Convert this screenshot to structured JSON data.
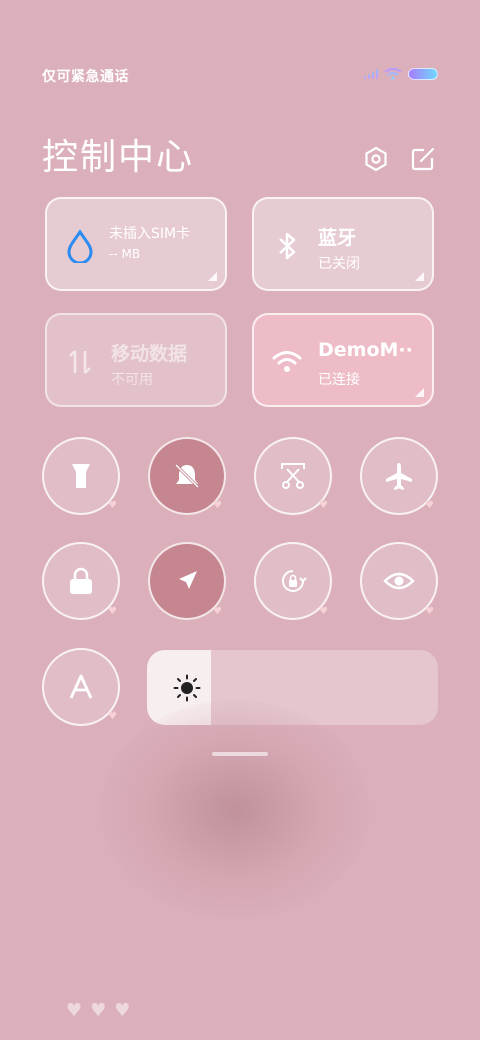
{
  "status_bar": {
    "carrier": "仅可紧急通话",
    "icons": [
      "signal-icon",
      "wifi-icon",
      "battery-icon"
    ]
  },
  "header": {
    "title": "控制中心",
    "settings_icon": "settings-icon",
    "edit_icon": "edit-icon"
  },
  "tiles": [
    {
      "name": "data-usage",
      "line1": "未插入SIM卡",
      "line2": "-- MB",
      "icon": "water-drop-icon",
      "state": "normal"
    },
    {
      "name": "bluetooth",
      "line1": "蓝牙",
      "line2": "已关闭",
      "icon": "bluetooth-icon",
      "state": "normal"
    },
    {
      "name": "mobile-data",
      "line1": "移动数据",
      "line2": "不可用",
      "icon": "data-arrows-icon",
      "state": "disabled"
    },
    {
      "name": "wifi",
      "line1": "DemoM··",
      "line2": "已连接",
      "icon": "wifi-icon",
      "state": "on"
    }
  ],
  "toggles": [
    {
      "name": "flashlight",
      "icon": "flashlight-icon",
      "on": false
    },
    {
      "name": "mute",
      "icon": "bell-off-icon",
      "on": true
    },
    {
      "name": "screenshot",
      "icon": "scissors-icon",
      "on": false
    },
    {
      "name": "airplane",
      "icon": "airplane-icon",
      "on": false
    },
    {
      "name": "lock-screen",
      "icon": "lock-icon",
      "on": false
    },
    {
      "name": "location",
      "icon": "location-arrow-icon",
      "on": true
    },
    {
      "name": "rotation-lock",
      "icon": "rotation-lock-icon",
      "on": false
    },
    {
      "name": "eye-comfort",
      "icon": "eye-icon",
      "on": false
    },
    {
      "name": "auto-text",
      "icon": "letter-a-icon",
      "on": false
    }
  ],
  "brightness": {
    "level": 0.22,
    "icon": "sun-icon"
  },
  "accent": "#dbb0bb"
}
